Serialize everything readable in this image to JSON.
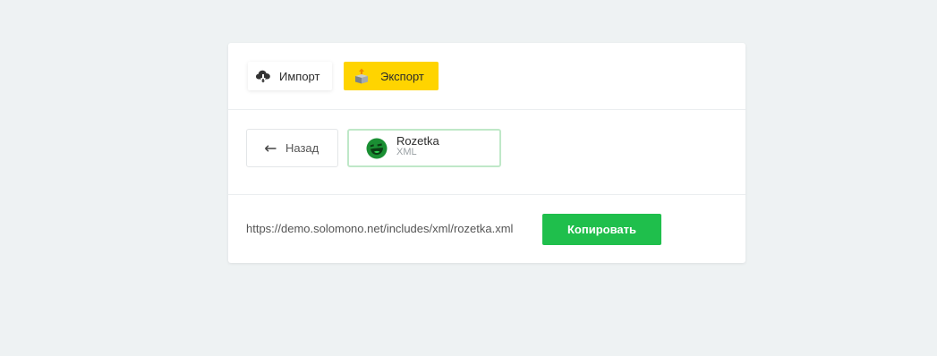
{
  "tabs": {
    "import": {
      "label": "Импорт",
      "icon": "cloud-download-icon"
    },
    "export": {
      "label": "Экспорт",
      "icon": "box-upload-icon",
      "active": true
    }
  },
  "source": {
    "back_label": "Назад",
    "back_icon": "arrow-left-icon",
    "name": "Rozetka",
    "format": "XML",
    "logo_icon": "rozetka-smiley-logo"
  },
  "export_link": {
    "url": "https://demo.solomono.net/includes/xml/rozetka.xml",
    "copy_label": "Копировать"
  },
  "colors": {
    "background": "#eef2f3",
    "accent_yellow": "#ffd400",
    "accent_green": "#1fbf4c",
    "selected_border": "#bfe8c8"
  }
}
